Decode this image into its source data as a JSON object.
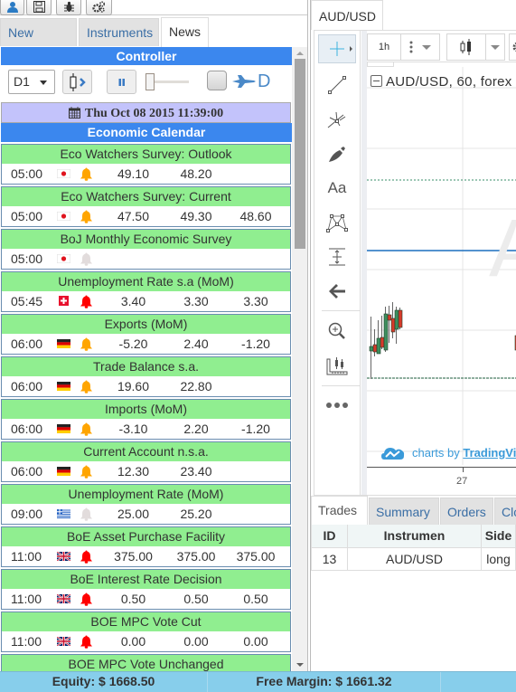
{
  "toolbar": {
    "buttons": [
      {
        "name": "user-icon"
      },
      {
        "name": "save-icon"
      },
      {
        "name": "bug-icon"
      },
      {
        "name": "settings-icon"
      }
    ]
  },
  "left_tabs": [
    {
      "label": "New Order",
      "active": false
    },
    {
      "label": "Instruments",
      "active": false
    },
    {
      "label": "News",
      "active": true
    }
  ],
  "controller": {
    "title": "Controller",
    "timeframe": "D1",
    "mode_label": "D",
    "slider_value": 0
  },
  "date_bar": {
    "icon": "calendar-icon",
    "text": "Thu Oct 08 2015 11:39:00"
  },
  "calendar": {
    "title": "Economic Calendar",
    "events": [
      {
        "title": "Eco Watchers Survey: Outlook",
        "time": "05:00",
        "country": "JP",
        "impact": "medium",
        "actual": "49.10",
        "forecast": "48.20",
        "previous": ""
      },
      {
        "title": "Eco Watchers Survey: Current",
        "time": "05:00",
        "country": "JP",
        "impact": "medium",
        "actual": "47.50",
        "forecast": "49.30",
        "previous": "48.60"
      },
      {
        "title": "BoJ Monthly Economic Survey",
        "time": "05:00",
        "country": "JP",
        "impact": "low",
        "actual": "",
        "forecast": "",
        "previous": ""
      },
      {
        "title": "Unemployment Rate s.a (MoM)",
        "time": "05:45",
        "country": "CH",
        "impact": "high",
        "actual": "3.40",
        "forecast": "3.30",
        "previous": "3.30"
      },
      {
        "title": "Exports (MoM)",
        "time": "06:00",
        "country": "DE",
        "impact": "medium",
        "actual": "-5.20",
        "forecast": "2.40",
        "previous": "-1.20"
      },
      {
        "title": "Trade Balance s.a.",
        "time": "06:00",
        "country": "DE",
        "impact": "medium",
        "actual": "19.60",
        "forecast": "22.80",
        "previous": ""
      },
      {
        "title": "Imports (MoM)",
        "time": "06:00",
        "country": "DE",
        "impact": "medium",
        "actual": "-3.10",
        "forecast": "2.20",
        "previous": "-1.20"
      },
      {
        "title": "Current Account n.s.a.",
        "time": "06:00",
        "country": "DE",
        "impact": "medium",
        "actual": "12.30",
        "forecast": "23.40",
        "previous": ""
      },
      {
        "title": "Unemployment Rate (MoM)",
        "time": "09:00",
        "country": "GR",
        "impact": "low",
        "actual": "25.00",
        "forecast": "25.20",
        "previous": ""
      },
      {
        "title": "BoE Asset Purchase Facility",
        "time": "11:00",
        "country": "GB",
        "impact": "high",
        "actual": "375.00",
        "forecast": "375.00",
        "previous": "375.00"
      },
      {
        "title": "BoE Interest Rate Decision",
        "time": "11:00",
        "country": "GB",
        "impact": "high",
        "actual": "0.50",
        "forecast": "0.50",
        "previous": "0.50"
      },
      {
        "title": "BOE MPC Vote Cut",
        "time": "11:00",
        "country": "GB",
        "impact": "high",
        "actual": "0.00",
        "forecast": "0.00",
        "previous": "0.00"
      },
      {
        "title": "BOE MPC Vote Unchanged",
        "time": "",
        "country": "",
        "impact": "",
        "actual": "",
        "forecast": "",
        "previous": ""
      }
    ]
  },
  "impact_colors": {
    "high": "#ff0000",
    "medium": "#ffa500",
    "low": "#e2dcdc"
  },
  "chart": {
    "tab_label": "AUD/USD",
    "interval": "1h",
    "legend": "AUD/USD, 60, forex",
    "watermark": "A",
    "brand_prefix": "charts by ",
    "brand_link": "TradingView",
    "x_tick": "27",
    "drawing_tools": [
      "crosshair-icon",
      "trend-line-icon",
      "pitchfork-icon",
      "brush-icon",
      "text-icon",
      "pattern-icon",
      "measure-icon",
      "arrow-left-icon",
      "zoom-in-icon",
      "ruler-icon",
      "more-icon"
    ]
  },
  "bottom_tabs": [
    {
      "label": "Trades",
      "active": true
    },
    {
      "label": "Summary",
      "active": false
    },
    {
      "label": "Orders",
      "active": false
    },
    {
      "label": "Closed",
      "active": false
    }
  ],
  "trades_table": {
    "headers": [
      "ID",
      "Instrumen",
      "Side"
    ],
    "rows": [
      [
        "13",
        "AUD/USD",
        "long"
      ]
    ]
  },
  "status": {
    "equity": "Equity: $ 1668.50",
    "free_margin": "Free Margin: $ 1661.32"
  }
}
